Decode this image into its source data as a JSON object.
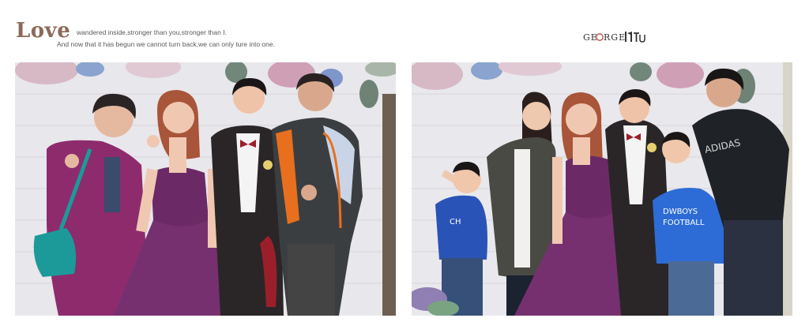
{
  "header": {
    "title_word": "Love",
    "tagline_line1": "wandered inside,stronger than you,stronger than I.",
    "tagline_line2": "And now that it has begun we cannot turn back,we can only ture into one.",
    "logo_text": "GEORGE TIU"
  },
  "photos": [
    {
      "name": "left",
      "subject": "bride, groom and parents"
    },
    {
      "name": "right",
      "subject": "bride, groom, family and children"
    }
  ],
  "colors": {
    "accent": "#8c6a5a",
    "dress": "#6b2a66",
    "wall": "#e9e8ec"
  }
}
